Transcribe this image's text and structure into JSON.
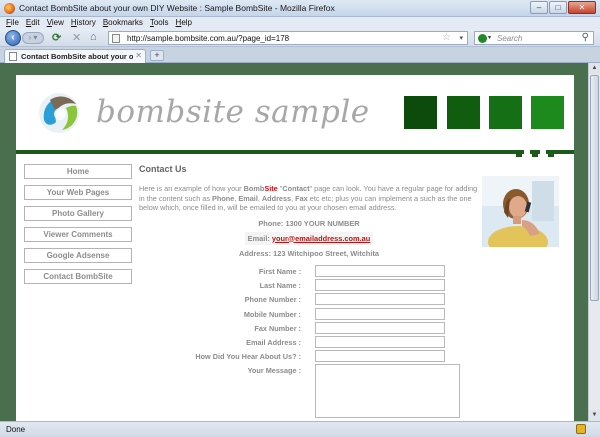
{
  "window": {
    "title": "Contact BombSite about your own DIY Website : Sample BombSite - Mozilla Firefox",
    "minimize": "–",
    "maximize": "□",
    "close": "✕"
  },
  "menubar": [
    "File",
    "Edit",
    "View",
    "History",
    "Bookmarks",
    "Tools",
    "Help"
  ],
  "navbar": {
    "url": "http://sample.bombsite.com.au/?page_id=178",
    "search_placeholder": "Search"
  },
  "tabs": [
    {
      "label": "Contact BombSite about your own DI..."
    }
  ],
  "site": {
    "title": "bombsite sample",
    "header_box_colors": [
      "#0d4b0d",
      "#105d10",
      "#157015",
      "#1c8a1c"
    ],
    "nav": [
      "Home",
      "Your Web Pages",
      "Photo Gallery",
      "Viewer Comments",
      "Google Adsense",
      "Contact BombSite"
    ]
  },
  "main": {
    "heading": "Contact Us",
    "intro_prefix": "Here is an example of how your ",
    "intro_bomb": "Bomb",
    "intro_site": "Site",
    "intro_mid1": " \"",
    "intro_contact": "Contact",
    "intro_mid2": "\" page can look. You have a regular page for adding in the content such as ",
    "intro_phone": "Phone",
    "intro_c1": ", ",
    "intro_email": "Email",
    "intro_c2": ", ",
    "intro_address": "Address",
    "intro_c3": ", ",
    "intro_fax": "Fax",
    "intro_suffix": " etc etc; plus you can implement a such as the one below which, once filled in, will be emailed to you at your chosen email address.",
    "phone": "Phone: 1300 YOUR NUMBER",
    "email_label": "Email: ",
    "email_value": "your@emailaddress.com.au",
    "address": "Address: 123 Witchipoo Street, Witchita"
  },
  "form": {
    "fields": [
      "First Name :",
      "Last Name :",
      "Phone Number :",
      "Mobile Number :",
      "Fax Number :",
      "Email Address :",
      "How Did You Hear About Us? :"
    ],
    "message_label": "Your Message :"
  },
  "status": {
    "text": "Done"
  }
}
